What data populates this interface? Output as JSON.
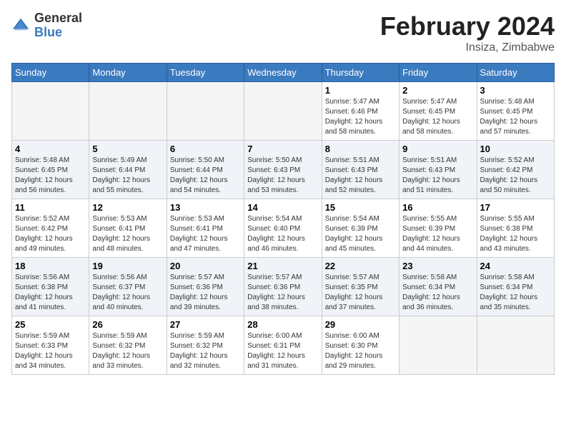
{
  "logo": {
    "general": "General",
    "blue": "Blue"
  },
  "header": {
    "title": "February 2024",
    "location": "Insiza, Zimbabwe"
  },
  "days_of_week": [
    "Sunday",
    "Monday",
    "Tuesday",
    "Wednesday",
    "Thursday",
    "Friday",
    "Saturday"
  ],
  "weeks": [
    [
      {
        "day": "",
        "empty": true
      },
      {
        "day": "",
        "empty": true
      },
      {
        "day": "",
        "empty": true
      },
      {
        "day": "",
        "empty": true
      },
      {
        "day": "1",
        "sunrise": "5:47 AM",
        "sunset": "6:46 PM",
        "daylight": "12 hours and 58 minutes."
      },
      {
        "day": "2",
        "sunrise": "5:47 AM",
        "sunset": "6:45 PM",
        "daylight": "12 hours and 58 minutes."
      },
      {
        "day": "3",
        "sunrise": "5:48 AM",
        "sunset": "6:45 PM",
        "daylight": "12 hours and 57 minutes."
      }
    ],
    [
      {
        "day": "4",
        "sunrise": "5:48 AM",
        "sunset": "6:45 PM",
        "daylight": "12 hours and 56 minutes."
      },
      {
        "day": "5",
        "sunrise": "5:49 AM",
        "sunset": "6:44 PM",
        "daylight": "12 hours and 55 minutes."
      },
      {
        "day": "6",
        "sunrise": "5:50 AM",
        "sunset": "6:44 PM",
        "daylight": "12 hours and 54 minutes."
      },
      {
        "day": "7",
        "sunrise": "5:50 AM",
        "sunset": "6:43 PM",
        "daylight": "12 hours and 53 minutes."
      },
      {
        "day": "8",
        "sunrise": "5:51 AM",
        "sunset": "6:43 PM",
        "daylight": "12 hours and 52 minutes."
      },
      {
        "day": "9",
        "sunrise": "5:51 AM",
        "sunset": "6:43 PM",
        "daylight": "12 hours and 51 minutes."
      },
      {
        "day": "10",
        "sunrise": "5:52 AM",
        "sunset": "6:42 PM",
        "daylight": "12 hours and 50 minutes."
      }
    ],
    [
      {
        "day": "11",
        "sunrise": "5:52 AM",
        "sunset": "6:42 PM",
        "daylight": "12 hours and 49 minutes."
      },
      {
        "day": "12",
        "sunrise": "5:53 AM",
        "sunset": "6:41 PM",
        "daylight": "12 hours and 48 minutes."
      },
      {
        "day": "13",
        "sunrise": "5:53 AM",
        "sunset": "6:41 PM",
        "daylight": "12 hours and 47 minutes."
      },
      {
        "day": "14",
        "sunrise": "5:54 AM",
        "sunset": "6:40 PM",
        "daylight": "12 hours and 46 minutes."
      },
      {
        "day": "15",
        "sunrise": "5:54 AM",
        "sunset": "6:39 PM",
        "daylight": "12 hours and 45 minutes."
      },
      {
        "day": "16",
        "sunrise": "5:55 AM",
        "sunset": "6:39 PM",
        "daylight": "12 hours and 44 minutes."
      },
      {
        "day": "17",
        "sunrise": "5:55 AM",
        "sunset": "6:38 PM",
        "daylight": "12 hours and 43 minutes."
      }
    ],
    [
      {
        "day": "18",
        "sunrise": "5:56 AM",
        "sunset": "6:38 PM",
        "daylight": "12 hours and 41 minutes."
      },
      {
        "day": "19",
        "sunrise": "5:56 AM",
        "sunset": "6:37 PM",
        "daylight": "12 hours and 40 minutes."
      },
      {
        "day": "20",
        "sunrise": "5:57 AM",
        "sunset": "6:36 PM",
        "daylight": "12 hours and 39 minutes."
      },
      {
        "day": "21",
        "sunrise": "5:57 AM",
        "sunset": "6:36 PM",
        "daylight": "12 hours and 38 minutes."
      },
      {
        "day": "22",
        "sunrise": "5:57 AM",
        "sunset": "6:35 PM",
        "daylight": "12 hours and 37 minutes."
      },
      {
        "day": "23",
        "sunrise": "5:58 AM",
        "sunset": "6:34 PM",
        "daylight": "12 hours and 36 minutes."
      },
      {
        "day": "24",
        "sunrise": "5:58 AM",
        "sunset": "6:34 PM",
        "daylight": "12 hours and 35 minutes."
      }
    ],
    [
      {
        "day": "25",
        "sunrise": "5:59 AM",
        "sunset": "6:33 PM",
        "daylight": "12 hours and 34 minutes."
      },
      {
        "day": "26",
        "sunrise": "5:59 AM",
        "sunset": "6:32 PM",
        "daylight": "12 hours and 33 minutes."
      },
      {
        "day": "27",
        "sunrise": "5:59 AM",
        "sunset": "6:32 PM",
        "daylight": "12 hours and 32 minutes."
      },
      {
        "day": "28",
        "sunrise": "6:00 AM",
        "sunset": "6:31 PM",
        "daylight": "12 hours and 31 minutes."
      },
      {
        "day": "29",
        "sunrise": "6:00 AM",
        "sunset": "6:30 PM",
        "daylight": "12 hours and 29 minutes."
      },
      {
        "day": "",
        "empty": true
      },
      {
        "day": "",
        "empty": true
      }
    ]
  ],
  "labels": {
    "sunrise_prefix": "Sunrise: ",
    "sunset_prefix": "Sunset: ",
    "daylight_prefix": "Daylight: "
  }
}
